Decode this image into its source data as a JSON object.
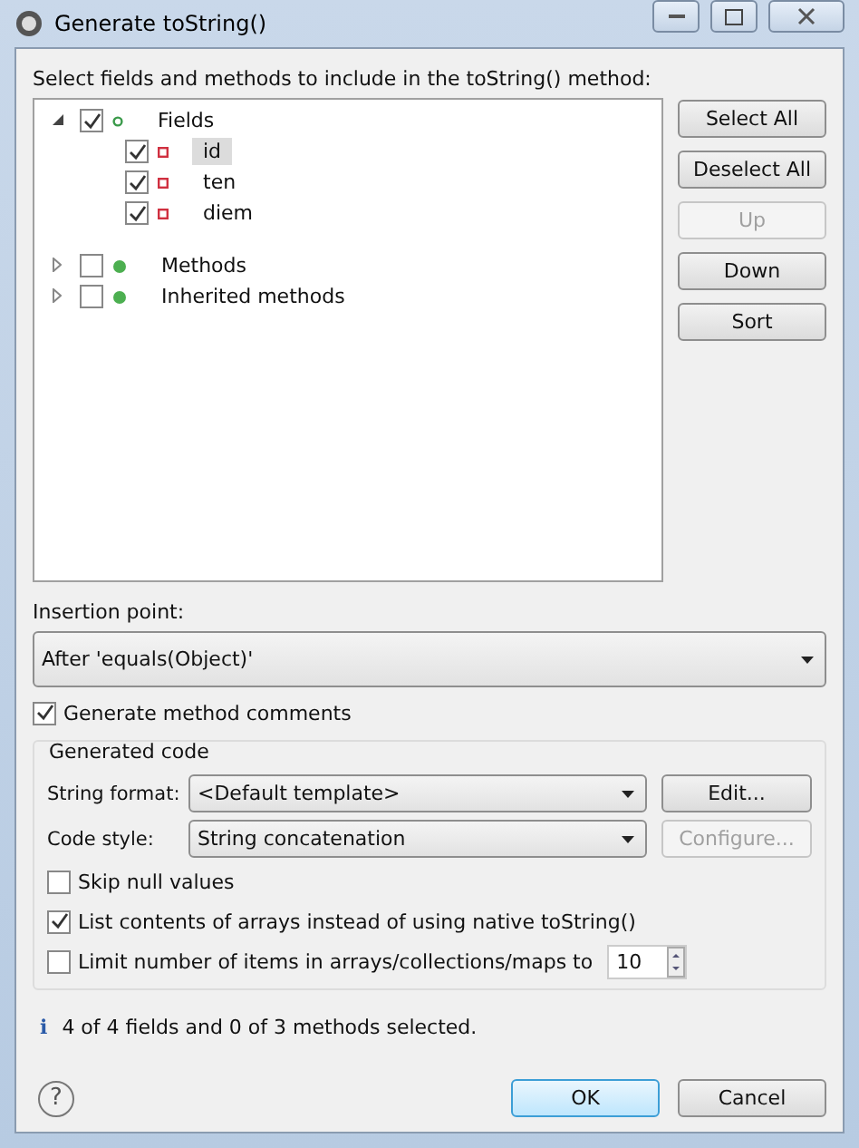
{
  "window": {
    "title": "Generate toString()"
  },
  "prompt": "Select fields and methods to include in the toString() method:",
  "tree": [
    {
      "label": "Fields",
      "expanded": true,
      "checked": true,
      "selected": false,
      "kind": "group",
      "children": [
        {
          "label": "id",
          "checked": true,
          "selected": true,
          "kind": "field"
        },
        {
          "label": "ten",
          "checked": true,
          "selected": false,
          "kind": "field"
        },
        {
          "label": "diem",
          "checked": true,
          "selected": false,
          "kind": "field"
        }
      ]
    },
    {
      "label": "Methods",
      "expanded": false,
      "checked": false,
      "selected": false,
      "kind": "method"
    },
    {
      "label": "Inherited methods",
      "expanded": false,
      "checked": false,
      "selected": false,
      "kind": "method"
    }
  ],
  "side_buttons": [
    {
      "label": "Select All",
      "disabled": false
    },
    {
      "label": "Deselect All",
      "disabled": false
    },
    {
      "label": "Up",
      "disabled": true
    },
    {
      "label": "Down",
      "disabled": false
    },
    {
      "label": "Sort",
      "disabled": false
    }
  ],
  "insertion_point": {
    "label": "Insertion point:",
    "value": "After 'equals(Object)'"
  },
  "generate_comments": {
    "label": "Generate method comments",
    "checked": true
  },
  "generated_code": {
    "title": "Generated code",
    "rows": [
      {
        "label": "String format:",
        "value": "<Default template>",
        "button": "Edit...",
        "disabled": false
      },
      {
        "label": "Code style:",
        "value": "String concatenation",
        "button": "Configure...",
        "disabled": true
      }
    ],
    "options": [
      {
        "label": "Skip null values",
        "checked": false
      },
      {
        "label": "List contents of arrays instead of using native toString()",
        "checked": true
      },
      {
        "label": "Limit number of items in arrays/collections/maps to",
        "checked": false,
        "value": "10"
      }
    ]
  },
  "status": "4 of 4 fields and 0 of 3 methods selected.",
  "status_icon": "i",
  "help_icon": "?",
  "buttons": [
    {
      "label": "OK",
      "default": true
    },
    {
      "label": "Cancel",
      "default": false
    }
  ]
}
